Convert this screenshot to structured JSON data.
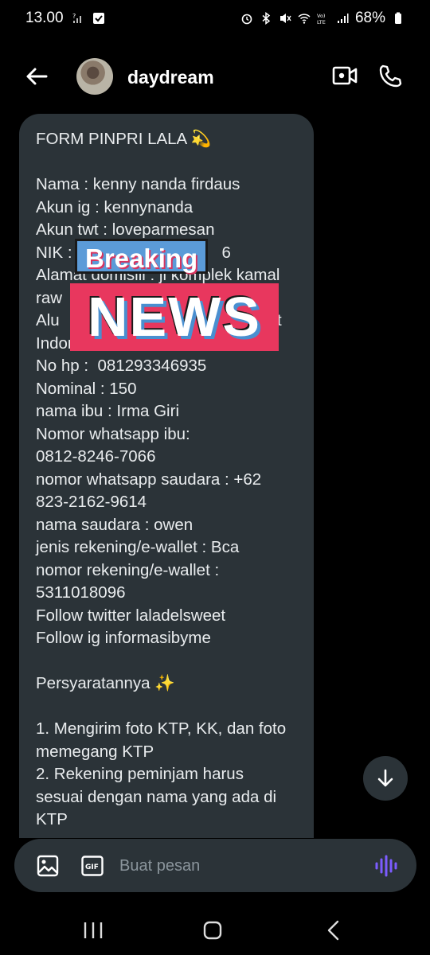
{
  "status_bar": {
    "time": "13.00",
    "battery": "68%",
    "icons": [
      "signal-mute-icon",
      "check-box-icon",
      "alarm-icon",
      "bluetooth-icon",
      "vibrate-mute-icon",
      "wifi-icon",
      "volte-icon",
      "cell-signal-icon",
      "battery-icon"
    ]
  },
  "header": {
    "contact_name": "daydream",
    "back_icon": "back-arrow-icon",
    "video_icon": "video-call-icon",
    "call_icon": "phone-icon"
  },
  "message": {
    "text": "FORM PINPRI LALA 💫\n\nNama : kenny nanda firdaus\nAkun ig : kennynanda\nAkun twt : loveparmesan\nNIK :                                 6\nAlamat domisili : jl komplek kamal\nraw\nAlu                                                t\nIndonesia 1152\nNo hp :  081293346935\nNominal : 150\nnama ibu : Irma Giri\nNomor whatsapp ibu:\n0812-8246-7066\nnomor whatsapp saudara : +62\n823-2162-9614\nnama saudara : owen\njenis rekening/e-wallet : Bca\nnomor rekening/e-wallet :\n5311018096\nFollow twitter laladelsweet\nFollow ig informasibyme\n\nPersyaratannya ✨\n\n1. Mengirim foto KTP, KK, dan foto\nmemegang KTP\n2. Rekening peminjam harus\nsesuai dengan nama yang ada di\nKTP"
  },
  "sticker": {
    "line1": "Breaking",
    "line2": "NEWS"
  },
  "composer": {
    "placeholder": "Buat pesan",
    "value": "",
    "gif_label": "GIF"
  },
  "colors": {
    "background": "#000000",
    "bubble": "#2b3338",
    "accent_voice": "#7c5cff",
    "breaking_blue": "#5b9bd8",
    "news_pink": "#e8375e"
  }
}
